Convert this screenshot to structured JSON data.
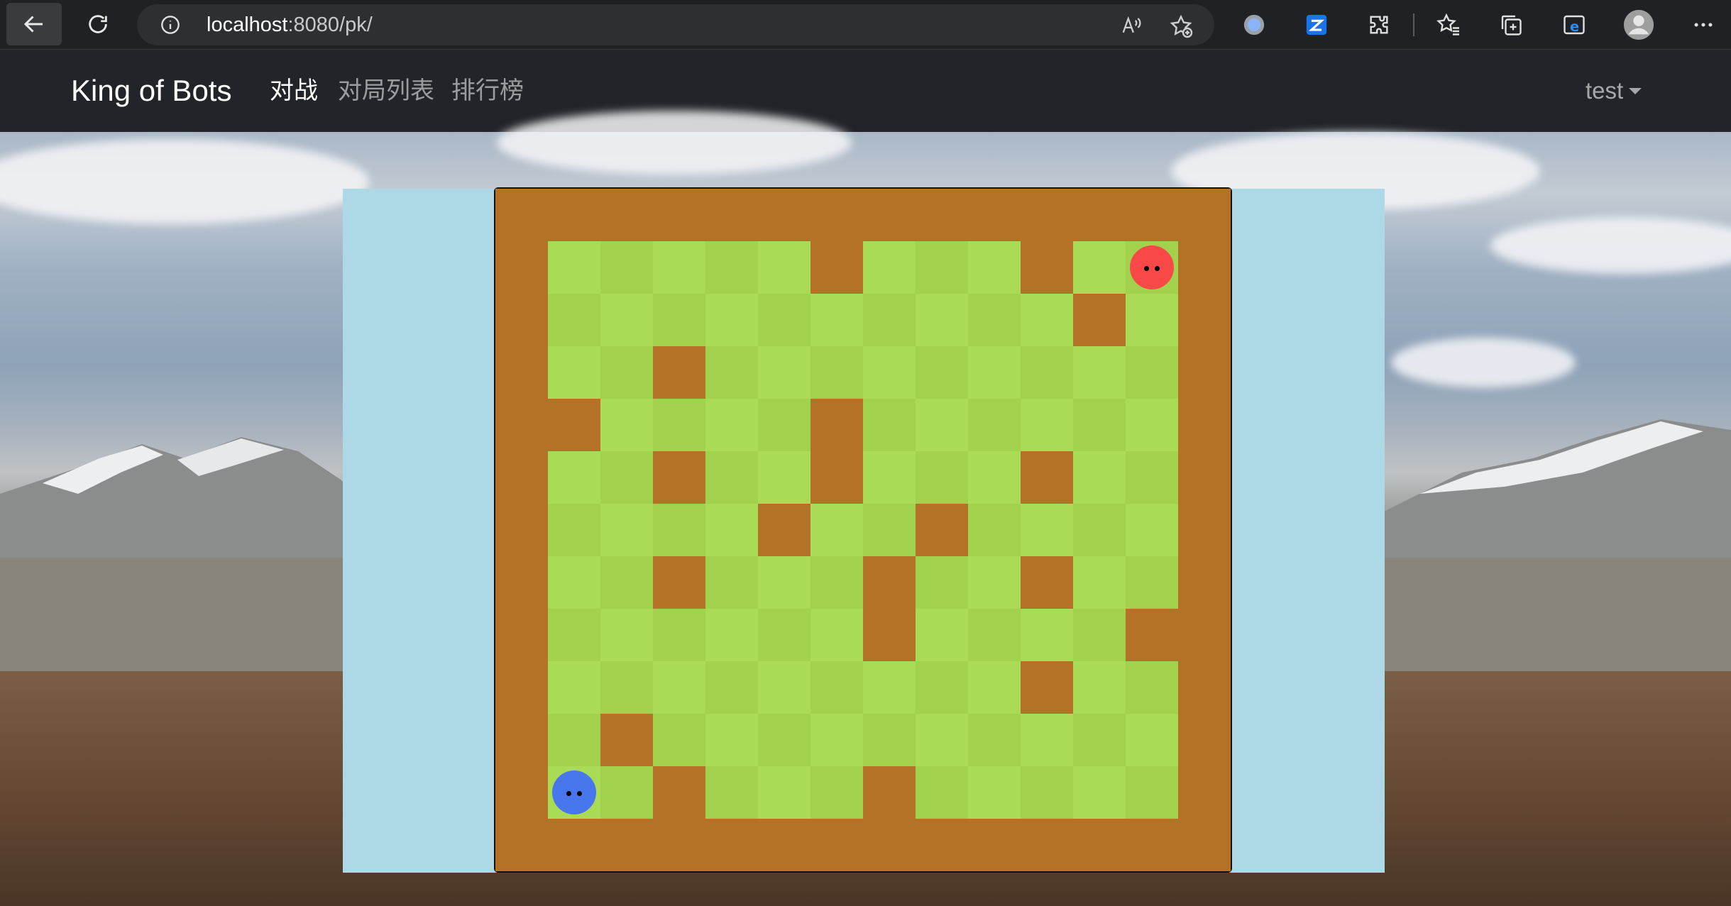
{
  "browser": {
    "url_host": "localhost",
    "url_path": ":8080/pk/"
  },
  "navbar": {
    "brand": "King of Bots",
    "links": [
      {
        "label": "对战",
        "active": true
      },
      {
        "label": "对局列表",
        "active": false
      },
      {
        "label": "排行榜",
        "active": false
      }
    ],
    "user": "test"
  },
  "game": {
    "rows": 13,
    "cols": 14,
    "colors": {
      "wall": "#b47226",
      "grass_light": "#aadb56",
      "grass_dark": "#a2d14d",
      "snake_red": "#f94848",
      "snake_blue": "#4876ec",
      "panel": "#add8e6"
    },
    "walls": [
      [
        0,
        0
      ],
      [
        0,
        1
      ],
      [
        0,
        2
      ],
      [
        0,
        3
      ],
      [
        0,
        4
      ],
      [
        0,
        5
      ],
      [
        0,
        6
      ],
      [
        0,
        7
      ],
      [
        0,
        8
      ],
      [
        0,
        9
      ],
      [
        0,
        10
      ],
      [
        0,
        11
      ],
      [
        0,
        12
      ],
      [
        0,
        13
      ],
      [
        12,
        0
      ],
      [
        12,
        1
      ],
      [
        12,
        2
      ],
      [
        12,
        3
      ],
      [
        12,
        4
      ],
      [
        12,
        5
      ],
      [
        12,
        6
      ],
      [
        12,
        7
      ],
      [
        12,
        8
      ],
      [
        12,
        9
      ],
      [
        12,
        10
      ],
      [
        12,
        11
      ],
      [
        12,
        12
      ],
      [
        12,
        13
      ],
      [
        1,
        0
      ],
      [
        2,
        0
      ],
      [
        3,
        0
      ],
      [
        4,
        0
      ],
      [
        5,
        0
      ],
      [
        6,
        0
      ],
      [
        7,
        0
      ],
      [
        8,
        0
      ],
      [
        9,
        0
      ],
      [
        10,
        0
      ],
      [
        11,
        0
      ],
      [
        1,
        13
      ],
      [
        2,
        13
      ],
      [
        3,
        13
      ],
      [
        4,
        13
      ],
      [
        5,
        13
      ],
      [
        6,
        13
      ],
      [
        7,
        13
      ],
      [
        8,
        13
      ],
      [
        9,
        13
      ],
      [
        10,
        13
      ],
      [
        11,
        13
      ],
      [
        1,
        6
      ],
      [
        1,
        10
      ],
      [
        2,
        11
      ],
      [
        3,
        3
      ],
      [
        4,
        1
      ],
      [
        4,
        6
      ],
      [
        5,
        3
      ],
      [
        5,
        6
      ],
      [
        5,
        10
      ],
      [
        6,
        5
      ],
      [
        6,
        8
      ],
      [
        7,
        3
      ],
      [
        7,
        7
      ],
      [
        7,
        10
      ],
      [
        8,
        7
      ],
      [
        8,
        12
      ],
      [
        9,
        10
      ],
      [
        10,
        2
      ],
      [
        11,
        3
      ],
      [
        11,
        7
      ]
    ],
    "snakes": [
      {
        "color": "red",
        "row": 1,
        "col": 12
      },
      {
        "color": "blue",
        "row": 11,
        "col": 1
      }
    ]
  }
}
